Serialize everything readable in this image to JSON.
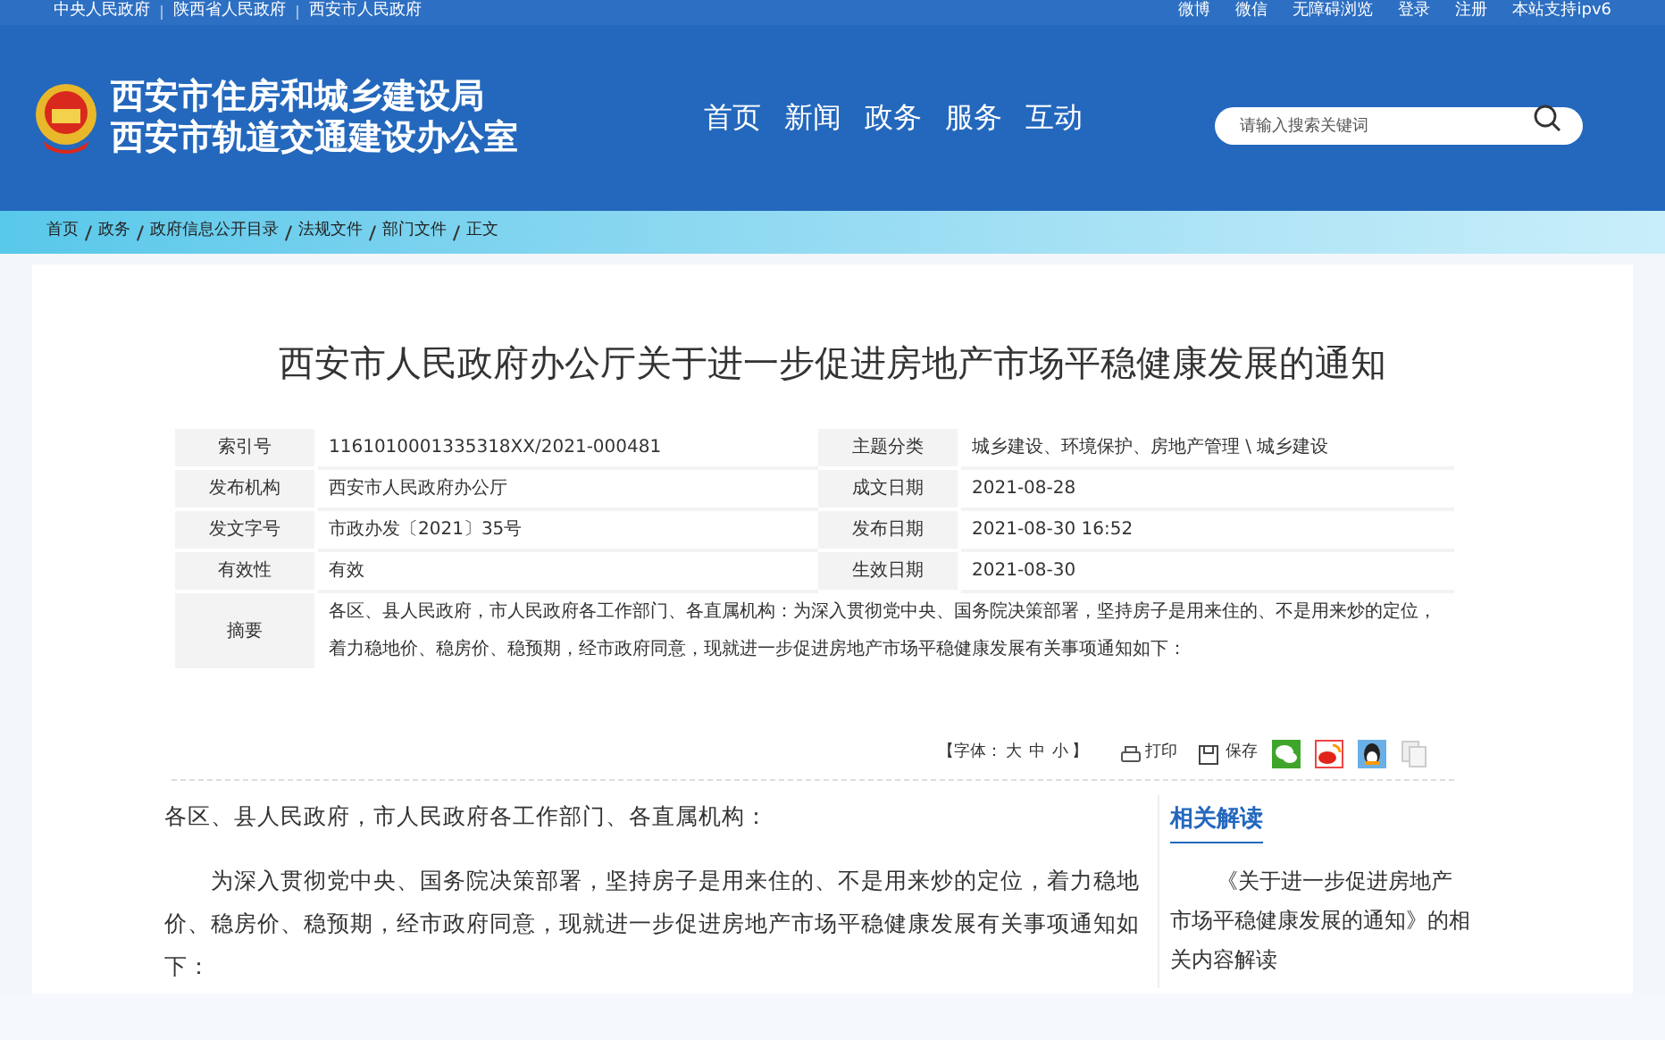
{
  "top_links": [
    "中央人民政府",
    "陕西省人民政府",
    "西安市人民政府"
  ],
  "top_right": [
    "微博",
    "微信",
    "无障碍浏览",
    "登录",
    "注册",
    "本站支持ipv6"
  ],
  "site_title": [
    "西安市住房和城乡建设局",
    "西安市轨道交通建设办公室"
  ],
  "nav": [
    "首页",
    "新闻",
    "政务",
    "服务",
    "互动"
  ],
  "search": {
    "placeholder": "请输入搜索关键词"
  },
  "breadcrumb": [
    "首页",
    "政务",
    "政府信息公开目录",
    "法规文件",
    "部门文件",
    "正文"
  ],
  "article_title": "西安市人民政府办公厅关于进一步促进房地产市场平稳健康发展的通知",
  "meta": [
    {
      "label": "索引号",
      "value": "1161010001335318XX/2021-000481",
      "label2": "主题分类",
      "value2": "城乡建设、环境保护、房地产管理 \\ 城乡建设"
    },
    {
      "label": "发布机构",
      "value": "西安市人民政府办公厅",
      "label2": "成文日期",
      "value2": "2021-08-28"
    },
    {
      "label": "发文字号",
      "value": "市政办发〔2021〕35号",
      "label2": "发布日期",
      "value2": "2021-08-30 16:52"
    },
    {
      "label": "有效性",
      "value": "有效",
      "label2": "生效日期",
      "value2": "2021-08-30"
    }
  ],
  "summary": {
    "label": "摘要",
    "value": "各区、县人民政府，市人民政府各工作部门、各直属机构：为深入贯彻党中央、国务院决策部署，坚持房子是用来住的、不是用来炒的定位，着力稳地价、稳房价、稳预期，经市政府同意，现就进一步促进房地产市场平稳健康发展有关事项通知如下："
  },
  "tools": {
    "font_label": "【字体：",
    "sizes": [
      "大",
      "中",
      "小"
    ],
    "font_end": "】",
    "print": "打印",
    "save": "保存"
  },
  "body": [
    "各区、县人民政府，市人民政府各工作部门、各直属机构：",
    "为深入贯彻党中央、国务院决策部署，坚持房子是用来住的、不是用来炒的定位，着力稳地价、稳房价、稳预期，经市政府同意，现就进一步促进房地产市场平稳健康发展有关事项通知如下："
  ],
  "related": {
    "title": "相关解读",
    "items": [
      "《关于进一步促进房地产市场平稳健康发展的通知》的相关内容解读"
    ]
  }
}
